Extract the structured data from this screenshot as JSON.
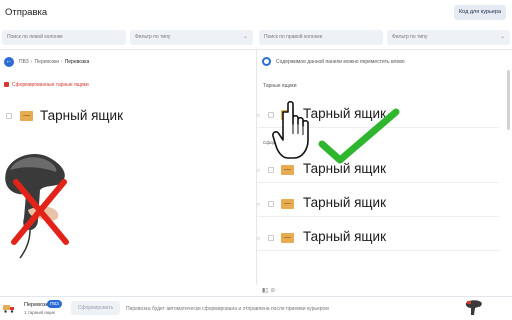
{
  "header": {
    "title": "Отправка",
    "courier_button": "Код для курьера"
  },
  "filters": {
    "left_search_placeholder": "Поиск по левой колонке",
    "left_type_filter": "Фильтр по типу",
    "right_search_placeholder": "Поиск по правой колонке",
    "right_type_filter": "Фильтр по типу"
  },
  "left_panel": {
    "breadcrumbs": [
      "ПВЗ",
      "Перевозки",
      "Перевозка"
    ],
    "notice": "Сформированные тарные ящики",
    "item_label": "Тарный ящик"
  },
  "right_panel": {
    "info": "Содержимое данной панели можно переместить влево",
    "section_label": "Тарные ящики",
    "sub_label": "Сформ...",
    "items": [
      {
        "label": "Тарный ящик"
      },
      {
        "label": "Тарный ящик"
      },
      {
        "label": "Тарный ящик"
      },
      {
        "label": "Тарный ящик"
      },
      {
        "label": "Тарный ящик"
      }
    ]
  },
  "bottom_bar": {
    "title": "Перевозка",
    "badge": "ПВЗ",
    "subtitle": "1 тарный ящик",
    "form_button": "Сформировать",
    "note": "Перевозка будет автоматически сформирована и отправлена после приемки курьером"
  },
  "colors": {
    "accent": "#2b6cd4",
    "box": "#e7ab54",
    "danger": "#e2231a",
    "success": "#2fb62f"
  }
}
